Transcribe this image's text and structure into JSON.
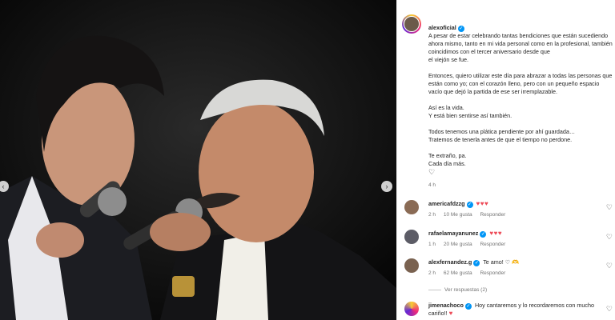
{
  "post": {
    "username": "alexoficial",
    "paragraphs": [
      "A pesar de estar celebrando tantas bendiciones que están sucediendo ahora mismo, tanto en mi vida personal como en la profesional, también coincidimos con el tercer aniversario desde que\nel viejón se fue.",
      "Entonces, quiero utilizar este día para abrazar a todas las personas que están como yo; con el corazón lleno, pero con un pequeño espacio vacío que dejó la partida de ese ser irremplazable.",
      "Así es la vida.\nY está bien sentirse así también.",
      "Todos tenemos una plática pendiente por ahí guardada…\nTratemos de tenerla antes de que el tiempo no perdone.",
      "Te extraño, pa.\nCada día más."
    ],
    "heart_icon": "♡",
    "time": "4 h"
  },
  "comments": [
    {
      "username": "americafdzzg",
      "text": "",
      "hearts": "♥♥♥",
      "time": "2 h",
      "likes": "10 Me gusta",
      "reply": "Responder"
    },
    {
      "username": "rafaelamayanunez",
      "text": "",
      "hearts": "♥♥♥",
      "time": "1 h",
      "likes": "20 Me gusta",
      "reply": "Responder"
    },
    {
      "username": "alexfernandez.g",
      "text": "Te amo! ♡ 🫶",
      "hearts": "",
      "time": "2 h",
      "likes": "62 Me gusta",
      "reply": "Responder"
    },
    {
      "username": "jimenachoco",
      "text": "Hoy cantaremos y lo recordaremos con mucho cariño!!",
      "hearts": "♥",
      "time": "",
      "likes": "",
      "reply": ""
    }
  ],
  "view_replies": "Ver respuestas (2)",
  "nav": {
    "prev": "‹",
    "next": "›"
  },
  "colors": {
    "verified": "#0095f6",
    "heart": "#ed4956",
    "meta": "#737373"
  }
}
